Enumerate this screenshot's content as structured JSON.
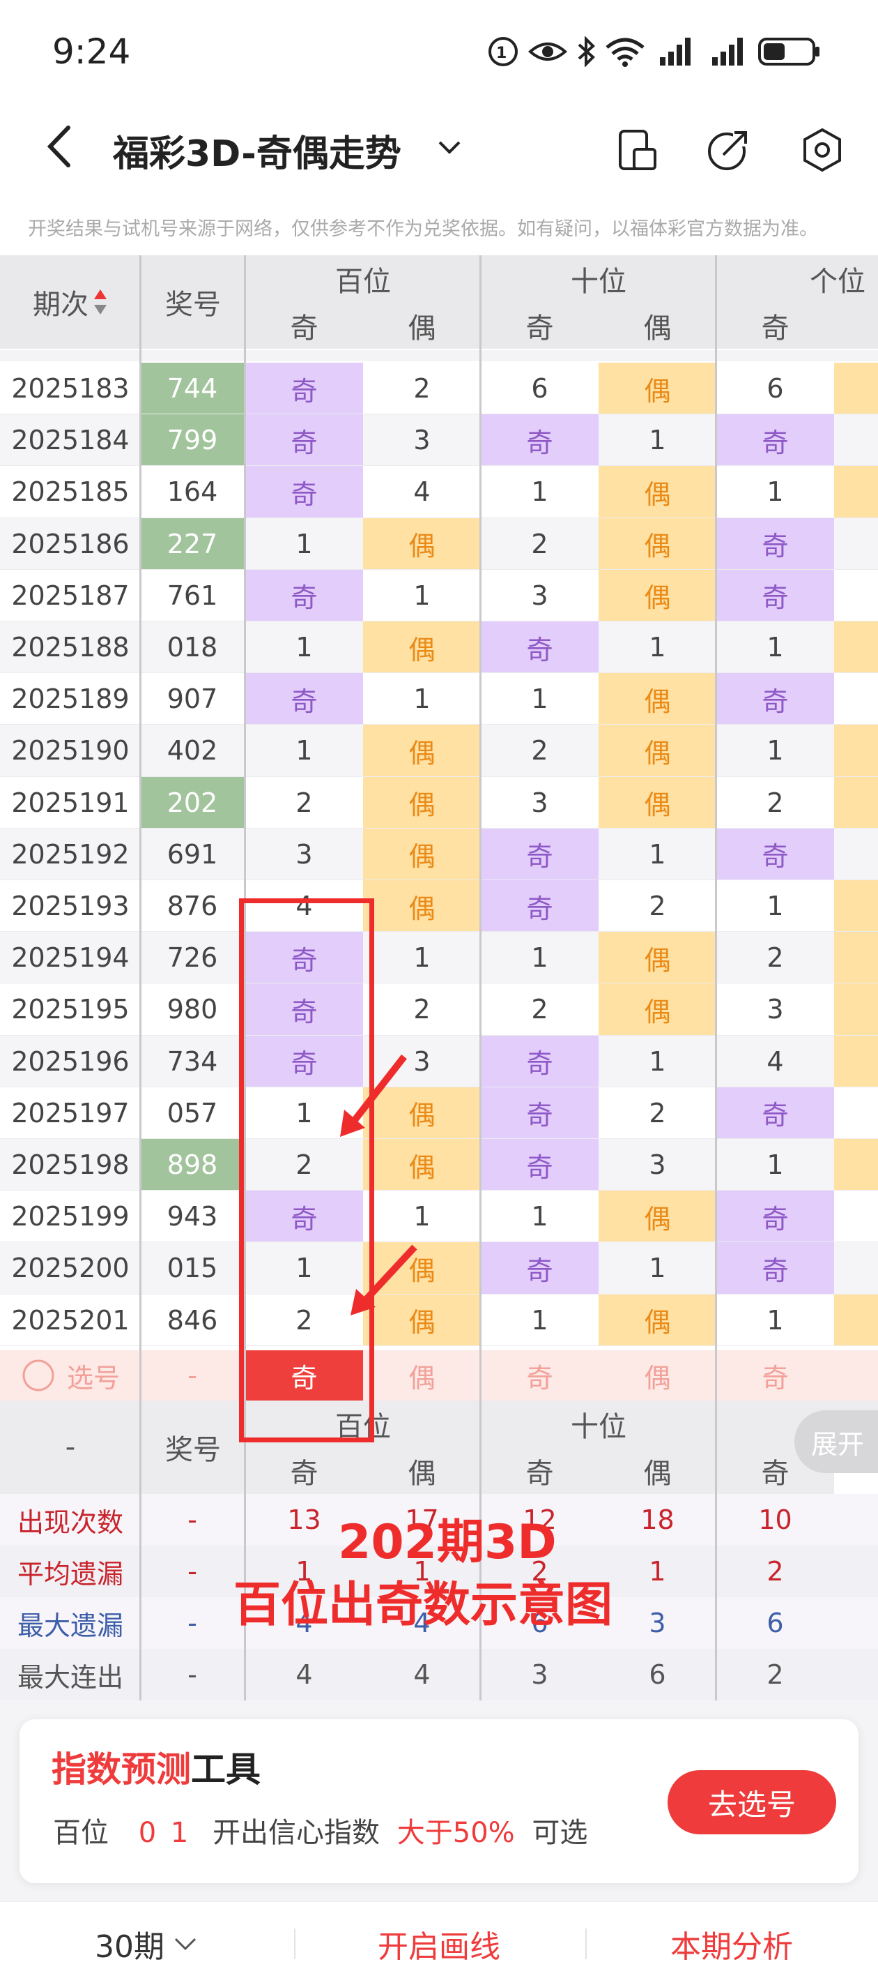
{
  "status_bar": {
    "time": "9:24",
    "icons": [
      "hd-icon",
      "eye-icon",
      "bluetooth-icon",
      "wifi-icon",
      "signal-icon",
      "signal-icon",
      "battery-icon"
    ]
  },
  "header": {
    "title": "福彩3D-奇偶走势",
    "disclaimer": "开奖结果与试机号来源于网络，仅供参考不作为兑奖依据。如有疑问，以福体彩官方数据为准。"
  },
  "table": {
    "col_period": "期次",
    "col_number": "奖号",
    "groups": [
      "百位",
      "十位",
      "个位"
    ],
    "sub": [
      "奇",
      "偶",
      "奇",
      "偶",
      "奇"
    ],
    "rows": [
      {
        "period": "2025183",
        "number": "744",
        "hl": true,
        "cells": [
          "奇",
          "2",
          "6",
          "偶",
          "6"
        ]
      },
      {
        "period": "2025184",
        "number": "799",
        "hl": true,
        "cells": [
          "奇",
          "3",
          "奇",
          "1",
          "奇"
        ]
      },
      {
        "period": "2025185",
        "number": "164",
        "hl": false,
        "cells": [
          "奇",
          "4",
          "1",
          "偶",
          "1"
        ]
      },
      {
        "period": "2025186",
        "number": "227",
        "hl": true,
        "cells": [
          "1",
          "偶",
          "2",
          "偶",
          "奇"
        ]
      },
      {
        "period": "2025187",
        "number": "761",
        "hl": false,
        "cells": [
          "奇",
          "1",
          "3",
          "偶",
          "奇"
        ]
      },
      {
        "period": "2025188",
        "number": "018",
        "hl": false,
        "cells": [
          "1",
          "偶",
          "奇",
          "1",
          "1"
        ]
      },
      {
        "period": "2025189",
        "number": "907",
        "hl": false,
        "cells": [
          "奇",
          "1",
          "1",
          "偶",
          "奇"
        ]
      },
      {
        "period": "2025190",
        "number": "402",
        "hl": false,
        "cells": [
          "1",
          "偶",
          "2",
          "偶",
          "1"
        ]
      },
      {
        "period": "2025191",
        "number": "202",
        "hl": true,
        "cells": [
          "2",
          "偶",
          "3",
          "偶",
          "2"
        ]
      },
      {
        "period": "2025192",
        "number": "691",
        "hl": false,
        "cells": [
          "3",
          "偶",
          "奇",
          "1",
          "奇"
        ]
      },
      {
        "period": "2025193",
        "number": "876",
        "hl": false,
        "cells": [
          "4",
          "偶",
          "奇",
          "2",
          "1"
        ]
      },
      {
        "period": "2025194",
        "number": "726",
        "hl": false,
        "cells": [
          "奇",
          "1",
          "1",
          "偶",
          "2"
        ]
      },
      {
        "period": "2025195",
        "number": "980",
        "hl": false,
        "cells": [
          "奇",
          "2",
          "2",
          "偶",
          "3"
        ]
      },
      {
        "period": "2025196",
        "number": "734",
        "hl": false,
        "cells": [
          "奇",
          "3",
          "奇",
          "1",
          "4"
        ]
      },
      {
        "period": "2025197",
        "number": "057",
        "hl": false,
        "cells": [
          "1",
          "偶",
          "奇",
          "2",
          "奇"
        ]
      },
      {
        "period": "2025198",
        "number": "898",
        "hl": true,
        "cells": [
          "2",
          "偶",
          "奇",
          "3",
          "1"
        ]
      },
      {
        "period": "2025199",
        "number": "943",
        "hl": false,
        "cells": [
          "奇",
          "1",
          "1",
          "偶",
          "奇"
        ]
      },
      {
        "period": "2025200",
        "number": "015",
        "hl": false,
        "cells": [
          "1",
          "偶",
          "奇",
          "1",
          "奇"
        ]
      },
      {
        "period": "2025201",
        "number": "846",
        "hl": false,
        "cells": [
          "2",
          "偶",
          "1",
          "偶",
          "1"
        ]
      }
    ],
    "select_row": {
      "label": "选号",
      "number": "-",
      "cells": [
        "奇",
        "偶",
        "奇",
        "偶",
        "奇"
      ]
    },
    "footer_groups": [
      "百位",
      "十位"
    ],
    "footer_dash": "-",
    "footer_number": "奖号",
    "expand": "展开",
    "stats": [
      {
        "label": "出现次数",
        "dash": "-",
        "values": [
          "13",
          "17",
          "12",
          "18",
          "10"
        ],
        "tone": "red"
      },
      {
        "label": "平均遗漏",
        "dash": "-",
        "values": [
          "1",
          "1",
          "2",
          "1",
          "2"
        ],
        "tone": "red"
      },
      {
        "label": "最大遗漏",
        "dash": "-",
        "values": [
          "4",
          "4",
          "6",
          "3",
          "6"
        ],
        "tone": "blue"
      },
      {
        "label": "最大连出",
        "dash": "-",
        "values": [
          "4",
          "4",
          "3",
          "6",
          "2"
        ],
        "tone": "dark"
      }
    ]
  },
  "annotation": {
    "line1": "202期3D",
    "line2": "百位出奇数示意图"
  },
  "tool": {
    "title_red": "指数预测",
    "title_black": "工具",
    "position": "百位",
    "digits": "0 1",
    "text": "开出信心指数",
    "threshold": "大于50%",
    "suffix": "可选",
    "button": "去选号"
  },
  "bottom_bar": {
    "periods": "30期",
    "draw": "开启画线",
    "analysis": "本期分析"
  },
  "colors": {
    "odd_bg": "#e2cdfb",
    "even_bg": "#ffe1a3",
    "highlight": "#a2c49c",
    "accent": "#ef3b3b"
  }
}
